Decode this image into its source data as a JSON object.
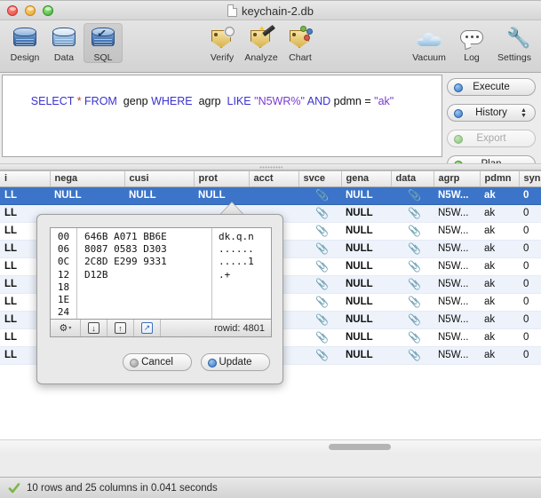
{
  "window": {
    "title": "keychain-2.db",
    "doc_icon": "document-icon",
    "traffic_lights": [
      "close-button",
      "minimize-button",
      "zoom-button"
    ]
  },
  "toolbar": {
    "left_items": [
      {
        "label": "Design",
        "icon": "database-design-icon",
        "selected": false
      },
      {
        "label": "Data",
        "icon": "database-data-icon",
        "selected": false
      },
      {
        "label": "SQL",
        "icon": "database-sql-icon",
        "selected": true
      }
    ],
    "mid_items": [
      {
        "label": "Verify",
        "icon": "verify-tag-icon"
      },
      {
        "label": "Analyze",
        "icon": "analyze-tag-icon"
      },
      {
        "label": "Chart",
        "icon": "chart-tag-icon"
      }
    ],
    "right_items": [
      {
        "label": "Vacuum",
        "icon": "cloud-icon"
      },
      {
        "label": "Log",
        "icon": "speech-bubble-icon"
      },
      {
        "label": "Settings",
        "icon": "wrench-icon"
      }
    ]
  },
  "sql": {
    "query": "SELECT * FROM genp WHERE agrp LIKE \"N5WR%\" AND pdmn = \"ak\"",
    "tokens": [
      {
        "t": "SELECT",
        "k": "kw"
      },
      {
        "t": " ",
        "k": "plain"
      },
      {
        "t": "*",
        "k": "star2"
      },
      {
        "t": " ",
        "k": "plain"
      },
      {
        "t": "FROM",
        "k": "kw"
      },
      {
        "t": "  genp ",
        "k": "plain"
      },
      {
        "t": "WHERE",
        "k": "kw"
      },
      {
        "t": "  agrp  ",
        "k": "plain"
      },
      {
        "t": "LIKE",
        "k": "kw"
      },
      {
        "t": " ",
        "k": "plain"
      },
      {
        "t": "\"N5WR%\"",
        "k": "str"
      },
      {
        "t": " ",
        "k": "plain"
      },
      {
        "t": "AND",
        "k": "kw"
      },
      {
        "t": " pdmn = ",
        "k": "plain"
      },
      {
        "t": "\"ak\"",
        "k": "str"
      }
    ]
  },
  "side_buttons": [
    {
      "label": "Execute",
      "led": "blue",
      "disabled": false,
      "stepper": false
    },
    {
      "label": "History",
      "led": "blue",
      "disabled": false,
      "stepper": true
    },
    {
      "label": "Export",
      "led": "greendim",
      "disabled": true,
      "stepper": false
    },
    {
      "label": "Plan",
      "led": "green",
      "disabled": false,
      "stepper": false
    }
  ],
  "results": {
    "columns": [
      "i",
      "nega",
      "cusi",
      "prot",
      "acct",
      "svce",
      "gena",
      "data",
      "agrp",
      "pdmn",
      "sync"
    ],
    "rows": [
      {
        "selected": true,
        "cells": [
          "LL",
          "NULL",
          "NULL",
          "NULL",
          "",
          "blob-clip-icon",
          "NULL",
          "blob-clip-icon",
          "N5W...",
          "ak",
          "0"
        ]
      },
      {
        "selected": false,
        "cells": [
          "LL",
          "",
          "",
          "",
          "",
          "blob-clip-icon",
          "NULL",
          "blob-clip-icon",
          "N5W...",
          "ak",
          "0"
        ]
      },
      {
        "selected": false,
        "cells": [
          "LL",
          "",
          "",
          "",
          "",
          "blob-clip-icon",
          "NULL",
          "blob-clip-icon",
          "N5W...",
          "ak",
          "0"
        ]
      },
      {
        "selected": false,
        "cells": [
          "LL",
          "",
          "",
          "",
          "",
          "blob-clip-icon",
          "NULL",
          "blob-clip-icon",
          "N5W...",
          "ak",
          "0"
        ]
      },
      {
        "selected": false,
        "cells": [
          "LL",
          "",
          "",
          "",
          "",
          "blob-clip-icon",
          "NULL",
          "blob-clip-icon",
          "N5W...",
          "ak",
          "0"
        ]
      },
      {
        "selected": false,
        "cells": [
          "LL",
          "",
          "",
          "",
          "",
          "blob-clip-icon",
          "NULL",
          "blob-clip-icon",
          "N5W...",
          "ak",
          "0"
        ]
      },
      {
        "selected": false,
        "cells": [
          "LL",
          "",
          "",
          "",
          "",
          "blob-clip-icon",
          "NULL",
          "blob-clip-icon",
          "N5W...",
          "ak",
          "0"
        ]
      },
      {
        "selected": false,
        "cells": [
          "LL",
          "",
          "",
          "",
          "",
          "blob-clip-icon",
          "NULL",
          "blob-clip-icon",
          "N5W...",
          "ak",
          "0"
        ]
      },
      {
        "selected": false,
        "cells": [
          "LL",
          "",
          "",
          "",
          "",
          "blob-clip-icon",
          "NULL",
          "blob-clip-icon",
          "N5W...",
          "ak",
          "0"
        ]
      },
      {
        "selected": false,
        "cells": [
          "LL",
          "",
          "",
          "",
          "",
          "blob-clip-icon",
          "NULL",
          "blob-clip-icon",
          "N5W...",
          "ak",
          "0"
        ]
      }
    ],
    "blob_glyph": "\u0001",
    "null_text": "NULL"
  },
  "popover": {
    "hex_offsets": "00\n06\n0C\n12\n18\n1E\n24",
    "hex_bytes": "646B A071 BB6E\n8087 0583 D303\n2C8D E299 9331\nD12B",
    "hex_ascii": "dk.q.n\n......\n.....1\n.+",
    "toolbar": {
      "gear_icon": "gear-icon",
      "gear_caret": "▾",
      "import_icon": "import-arrow-down-icon",
      "import_glyph": "↓",
      "export_icon": "export-arrow-up-icon",
      "export_glyph": "↑",
      "open_external_icon": "open-external-icon",
      "open_external_glyph": "↗",
      "rowid_label": "rowid: 4801"
    },
    "cancel_label": "Cancel",
    "update_label": "Update"
  },
  "statusbar": {
    "icon": "success-check-icon",
    "text": "10 rows and 25 columns in 0.041 seconds"
  },
  "colors": {
    "selection_blue": "#3b74c8",
    "null_red": "#d0021b",
    "keyword_blue": "#3a32d0",
    "string_purple": "#7a3ad0",
    "alt_row": "#edf2fb",
    "success_green": "#7ab648"
  }
}
